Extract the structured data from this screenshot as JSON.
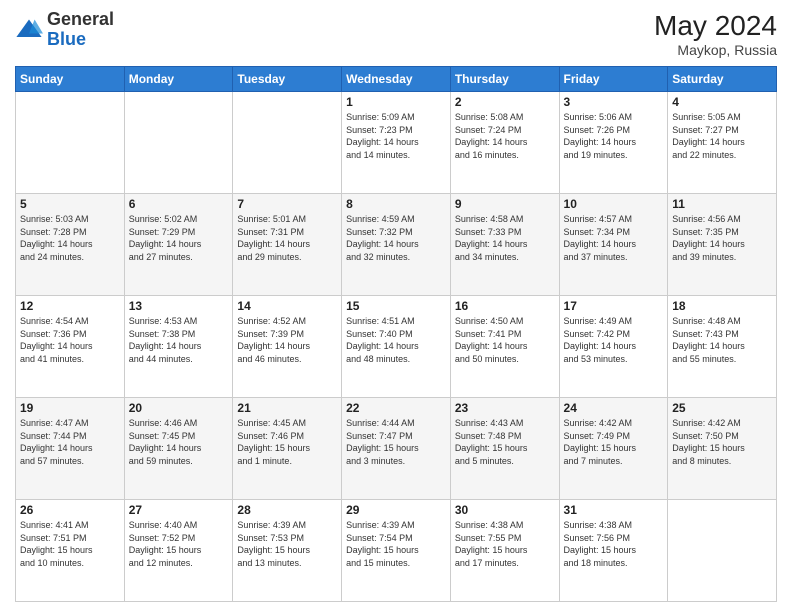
{
  "header": {
    "logo_general": "General",
    "logo_blue": "Blue",
    "month_year": "May 2024",
    "location": "Maykop, Russia"
  },
  "days_of_week": [
    "Sunday",
    "Monday",
    "Tuesday",
    "Wednesday",
    "Thursday",
    "Friday",
    "Saturday"
  ],
  "weeks": [
    [
      {
        "day": "",
        "info": ""
      },
      {
        "day": "",
        "info": ""
      },
      {
        "day": "",
        "info": ""
      },
      {
        "day": "1",
        "info": "Sunrise: 5:09 AM\nSunset: 7:23 PM\nDaylight: 14 hours\nand 14 minutes."
      },
      {
        "day": "2",
        "info": "Sunrise: 5:08 AM\nSunset: 7:24 PM\nDaylight: 14 hours\nand 16 minutes."
      },
      {
        "day": "3",
        "info": "Sunrise: 5:06 AM\nSunset: 7:26 PM\nDaylight: 14 hours\nand 19 minutes."
      },
      {
        "day": "4",
        "info": "Sunrise: 5:05 AM\nSunset: 7:27 PM\nDaylight: 14 hours\nand 22 minutes."
      }
    ],
    [
      {
        "day": "5",
        "info": "Sunrise: 5:03 AM\nSunset: 7:28 PM\nDaylight: 14 hours\nand 24 minutes."
      },
      {
        "day": "6",
        "info": "Sunrise: 5:02 AM\nSunset: 7:29 PM\nDaylight: 14 hours\nand 27 minutes."
      },
      {
        "day": "7",
        "info": "Sunrise: 5:01 AM\nSunset: 7:31 PM\nDaylight: 14 hours\nand 29 minutes."
      },
      {
        "day": "8",
        "info": "Sunrise: 4:59 AM\nSunset: 7:32 PM\nDaylight: 14 hours\nand 32 minutes."
      },
      {
        "day": "9",
        "info": "Sunrise: 4:58 AM\nSunset: 7:33 PM\nDaylight: 14 hours\nand 34 minutes."
      },
      {
        "day": "10",
        "info": "Sunrise: 4:57 AM\nSunset: 7:34 PM\nDaylight: 14 hours\nand 37 minutes."
      },
      {
        "day": "11",
        "info": "Sunrise: 4:56 AM\nSunset: 7:35 PM\nDaylight: 14 hours\nand 39 minutes."
      }
    ],
    [
      {
        "day": "12",
        "info": "Sunrise: 4:54 AM\nSunset: 7:36 PM\nDaylight: 14 hours\nand 41 minutes."
      },
      {
        "day": "13",
        "info": "Sunrise: 4:53 AM\nSunset: 7:38 PM\nDaylight: 14 hours\nand 44 minutes."
      },
      {
        "day": "14",
        "info": "Sunrise: 4:52 AM\nSunset: 7:39 PM\nDaylight: 14 hours\nand 46 minutes."
      },
      {
        "day": "15",
        "info": "Sunrise: 4:51 AM\nSunset: 7:40 PM\nDaylight: 14 hours\nand 48 minutes."
      },
      {
        "day": "16",
        "info": "Sunrise: 4:50 AM\nSunset: 7:41 PM\nDaylight: 14 hours\nand 50 minutes."
      },
      {
        "day": "17",
        "info": "Sunrise: 4:49 AM\nSunset: 7:42 PM\nDaylight: 14 hours\nand 53 minutes."
      },
      {
        "day": "18",
        "info": "Sunrise: 4:48 AM\nSunset: 7:43 PM\nDaylight: 14 hours\nand 55 minutes."
      }
    ],
    [
      {
        "day": "19",
        "info": "Sunrise: 4:47 AM\nSunset: 7:44 PM\nDaylight: 14 hours\nand 57 minutes."
      },
      {
        "day": "20",
        "info": "Sunrise: 4:46 AM\nSunset: 7:45 PM\nDaylight: 14 hours\nand 59 minutes."
      },
      {
        "day": "21",
        "info": "Sunrise: 4:45 AM\nSunset: 7:46 PM\nDaylight: 15 hours\nand 1 minute."
      },
      {
        "day": "22",
        "info": "Sunrise: 4:44 AM\nSunset: 7:47 PM\nDaylight: 15 hours\nand 3 minutes."
      },
      {
        "day": "23",
        "info": "Sunrise: 4:43 AM\nSunset: 7:48 PM\nDaylight: 15 hours\nand 5 minutes."
      },
      {
        "day": "24",
        "info": "Sunrise: 4:42 AM\nSunset: 7:49 PM\nDaylight: 15 hours\nand 7 minutes."
      },
      {
        "day": "25",
        "info": "Sunrise: 4:42 AM\nSunset: 7:50 PM\nDaylight: 15 hours\nand 8 minutes."
      }
    ],
    [
      {
        "day": "26",
        "info": "Sunrise: 4:41 AM\nSunset: 7:51 PM\nDaylight: 15 hours\nand 10 minutes."
      },
      {
        "day": "27",
        "info": "Sunrise: 4:40 AM\nSunset: 7:52 PM\nDaylight: 15 hours\nand 12 minutes."
      },
      {
        "day": "28",
        "info": "Sunrise: 4:39 AM\nSunset: 7:53 PM\nDaylight: 15 hours\nand 13 minutes."
      },
      {
        "day": "29",
        "info": "Sunrise: 4:39 AM\nSunset: 7:54 PM\nDaylight: 15 hours\nand 15 minutes."
      },
      {
        "day": "30",
        "info": "Sunrise: 4:38 AM\nSunset: 7:55 PM\nDaylight: 15 hours\nand 17 minutes."
      },
      {
        "day": "31",
        "info": "Sunrise: 4:38 AM\nSunset: 7:56 PM\nDaylight: 15 hours\nand 18 minutes."
      },
      {
        "day": "",
        "info": ""
      }
    ]
  ]
}
